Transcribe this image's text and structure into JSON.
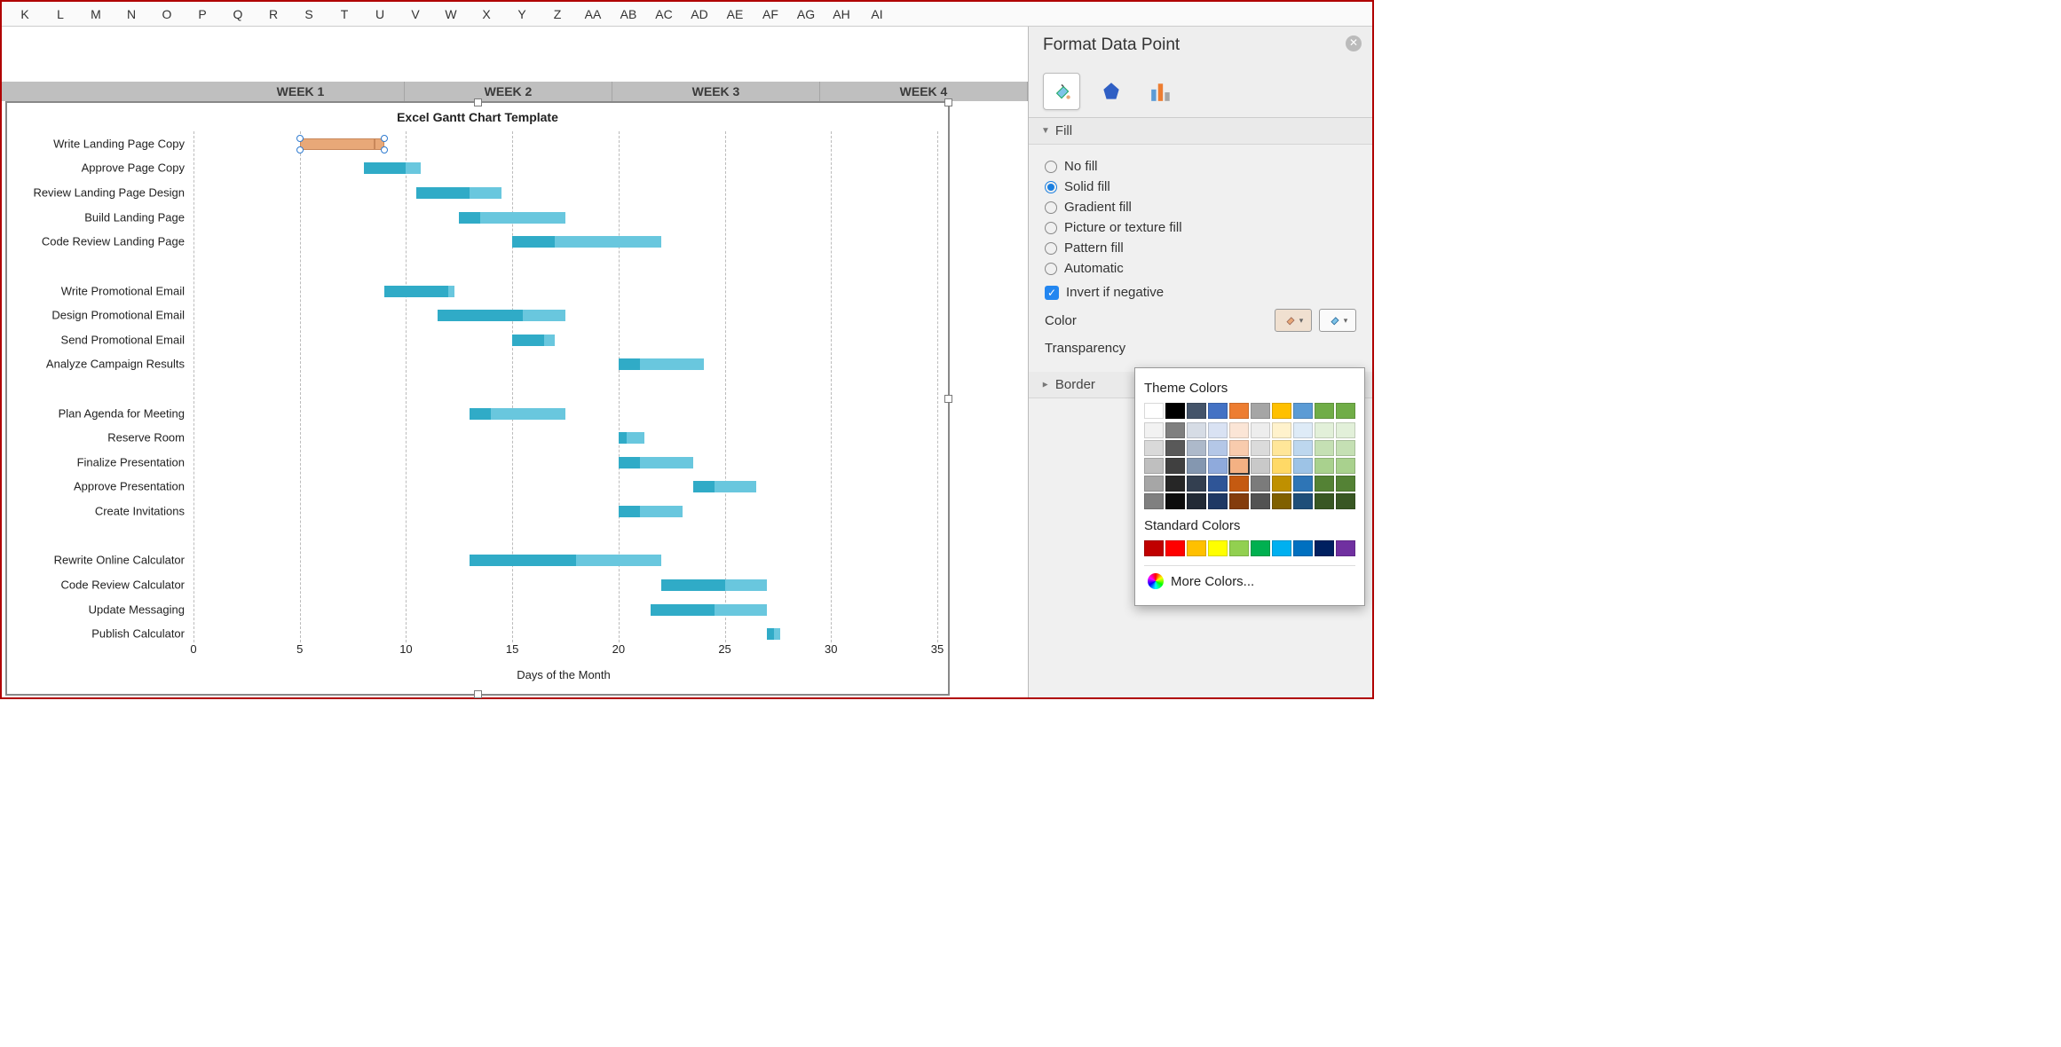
{
  "columns": [
    "K",
    "L",
    "M",
    "N",
    "O",
    "P",
    "Q",
    "R",
    "S",
    "T",
    "U",
    "V",
    "W",
    "X",
    "Y",
    "Z",
    "AA",
    "AB",
    "AC",
    "AD",
    "AE",
    "AF",
    "AG",
    "AH",
    "AI"
  ],
  "weeks": [
    "WEEK 1",
    "WEEK 2",
    "WEEK 3",
    "WEEK 4"
  ],
  "panel": {
    "title": "Format Data Point",
    "fill_label": "Fill",
    "border_label": "Border",
    "options": {
      "none": "No fill",
      "solid": "Solid fill",
      "gradient": "Gradient fill",
      "picture": "Picture or texture fill",
      "pattern": "Pattern fill",
      "auto": "Automatic"
    },
    "invert": "Invert if negative",
    "color_label": "Color",
    "transparency_label": "Transparency",
    "popup": {
      "theme": "Theme Colors",
      "standard": "Standard Colors",
      "more": "More Colors..."
    }
  },
  "chart_data": {
    "type": "bar",
    "title": "Excel Gantt Chart Template",
    "xlabel": "Days of the Month",
    "ylabel": "",
    "x_ticks": [
      0,
      5,
      10,
      15,
      20,
      25,
      30,
      35
    ],
    "xlim": [
      0,
      35
    ],
    "tasks": [
      {
        "label": "Write Landing Page Copy",
        "start": 5,
        "dur1": 3.5,
        "dur2": 0.5,
        "selected": true
      },
      {
        "label": "Approve Page Copy",
        "start": 8,
        "dur1": 2,
        "dur2": 0.7
      },
      {
        "label": "Review Landing Page Design",
        "start": 10.5,
        "dur1": 2.5,
        "dur2": 1.5
      },
      {
        "label": "Build Landing Page",
        "start": 12.5,
        "dur1": 1,
        "dur2": 4
      },
      {
        "label": "Code Review Landing Page",
        "start": 15,
        "dur1": 2,
        "dur2": 5
      },
      {
        "label": "",
        "blank": true
      },
      {
        "label": "Write Promotional Email",
        "start": 9,
        "dur1": 3,
        "dur2": 0.3
      },
      {
        "label": "Design Promotional Email",
        "start": 11.5,
        "dur1": 4,
        "dur2": 2
      },
      {
        "label": "Send Promotional Email",
        "start": 15,
        "dur1": 1.5,
        "dur2": 0.5
      },
      {
        "label": "Analyze Campaign Results",
        "start": 20,
        "dur1": 1,
        "dur2": 3
      },
      {
        "label": "",
        "blank": true
      },
      {
        "label": "Plan Agenda for Meeting",
        "start": 13,
        "dur1": 1,
        "dur2": 3.5
      },
      {
        "label": "Reserve Room",
        "start": 20,
        "dur1": 0.4,
        "dur2": 0.8
      },
      {
        "label": "Finalize Presentation",
        "start": 20,
        "dur1": 1,
        "dur2": 2.5
      },
      {
        "label": "Approve Presentation",
        "start": 23.5,
        "dur1": 1,
        "dur2": 2
      },
      {
        "label": "Create Invitations",
        "start": 20,
        "dur1": 1,
        "dur2": 2
      },
      {
        "label": "",
        "blank": true
      },
      {
        "label": "Rewrite Online Calculator",
        "start": 13,
        "dur1": 5,
        "dur2": 4
      },
      {
        "label": "Code Review Calculator",
        "start": 22,
        "dur1": 3,
        "dur2": 2
      },
      {
        "label": "Update Messaging",
        "start": 21.5,
        "dur1": 3,
        "dur2": 2.5
      },
      {
        "label": "Publish Calculator",
        "start": 27,
        "dur1": 0.3,
        "dur2": 0.3
      }
    ]
  },
  "theme_colors": {
    "row1": [
      "#ffffff",
      "#000000",
      "#44546a",
      "#4472c4",
      "#ed7d31",
      "#a5a5a5",
      "#ffc000",
      "#5b9bd5",
      "#70ad47",
      "#70ad47"
    ],
    "shades": [
      [
        "#f2f2f2",
        "#7f7f7f",
        "#d6dce5",
        "#d9e2f3",
        "#fbe5d6",
        "#ededed",
        "#fff2cc",
        "#deebf7",
        "#e2f0d9",
        "#e2f0d9"
      ],
      [
        "#d9d9d9",
        "#595959",
        "#adb9ca",
        "#b4c7e7",
        "#f8cbad",
        "#dbdbdb",
        "#ffe699",
        "#bdd7ee",
        "#c5e0b4",
        "#c5e0b4"
      ],
      [
        "#bfbfbf",
        "#404040",
        "#8497b0",
        "#8faadc",
        "#f4b183",
        "#c9c9c9",
        "#ffd966",
        "#9dc3e6",
        "#a9d18e",
        "#a9d18e"
      ],
      [
        "#a6a6a6",
        "#262626",
        "#333f50",
        "#2f5597",
        "#c55a11",
        "#7b7b7b",
        "#bf9000",
        "#2e75b6",
        "#548235",
        "#548235"
      ],
      [
        "#808080",
        "#0d0d0d",
        "#222a35",
        "#1f3864",
        "#843c0c",
        "#525252",
        "#806000",
        "#1f4e79",
        "#385723",
        "#385723"
      ]
    ]
  },
  "standard_colors": [
    "#c00000",
    "#ff0000",
    "#ffc000",
    "#ffff00",
    "#92d050",
    "#00b050",
    "#00b0f0",
    "#0070c0",
    "#002060",
    "#7030a0"
  ],
  "selected_swatch": "#f4b183"
}
